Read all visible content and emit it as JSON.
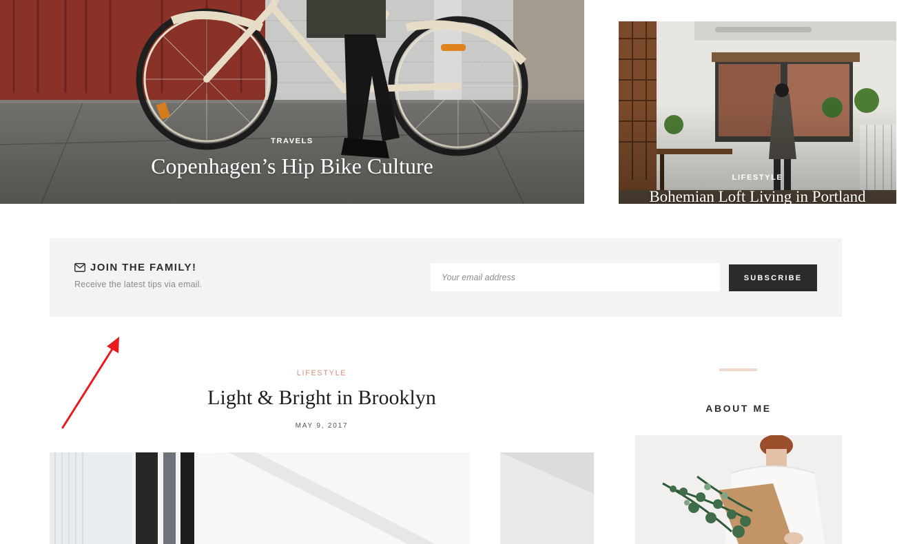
{
  "featured": [
    {
      "category": "TRAVELS",
      "title": "Copenhagen’s Hip Bike Culture"
    },
    {
      "category": "LIFESTYLE",
      "title": "Bohemian Loft Living in Portland"
    }
  ],
  "newsletter": {
    "icon": "envelope-icon",
    "title": "JOIN THE FAMILY!",
    "subtitle": "Receive the latest tips via email.",
    "email_placeholder": "Your email address",
    "subscribe_label": "SUBSCRIBE"
  },
  "post": {
    "category": "LIFESTYLE",
    "title": "Light & Bright in Brooklyn",
    "date": "MAY 9, 2017"
  },
  "sidebar": {
    "about_title": "ABOUT ME"
  },
  "colors": {
    "accent": "#d7907a",
    "button_bg": "#2b2b2b",
    "newsletter_bg": "#f3f3f3",
    "rule": "#efd8cd",
    "annotation": "#e8191f"
  }
}
